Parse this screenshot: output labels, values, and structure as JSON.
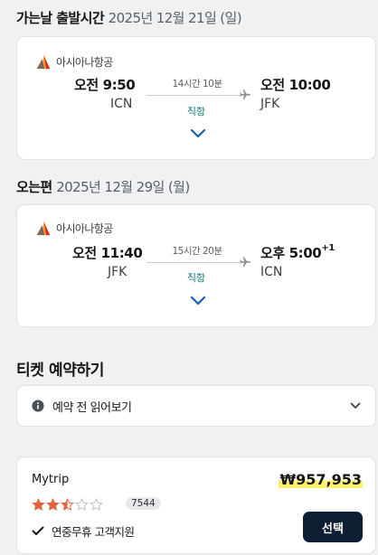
{
  "outbound": {
    "title": "가는날 출발시간",
    "date": "2025년 12월 21일 (일)",
    "airline": "아시아나항공",
    "depart_time": "오전 9:50",
    "depart_airport": "ICN",
    "duration": "14시간 10분",
    "stops": "직항",
    "arrive_time": "오전 10:00",
    "arrive_day_offset": "",
    "arrive_airport": "JFK"
  },
  "inbound": {
    "title": "오는편",
    "date": "2025년 12월 29일 (월)",
    "airline": "아시아나항공",
    "depart_time": "오전 11:40",
    "depart_airport": "JFK",
    "duration": "15시간 20분",
    "stops": "직항",
    "arrive_time": "오후 5:00",
    "arrive_day_offset": "+1",
    "arrive_airport": "ICN"
  },
  "booking": {
    "title": "티켓 예약하기",
    "read_before_label": "예약 전 읽어보기"
  },
  "offer": {
    "provider": "Mytrip",
    "price": "₩957,953",
    "rating": 2.5,
    "rating_max": 5,
    "review_count": "7544",
    "feature": "연중무휴 고객지원",
    "select_label": "선택"
  },
  "colors": {
    "accent_teal": "#0a7b73",
    "chevron_blue": "#1a5fb4",
    "star_orange": "#e1653c",
    "button_dark": "#0c1f33",
    "price_highlight": "#fff06a"
  },
  "icons": [
    "asiana-logo-icon",
    "plane-icon",
    "chevron-down-icon",
    "info-icon",
    "star-icon",
    "check-icon"
  ]
}
